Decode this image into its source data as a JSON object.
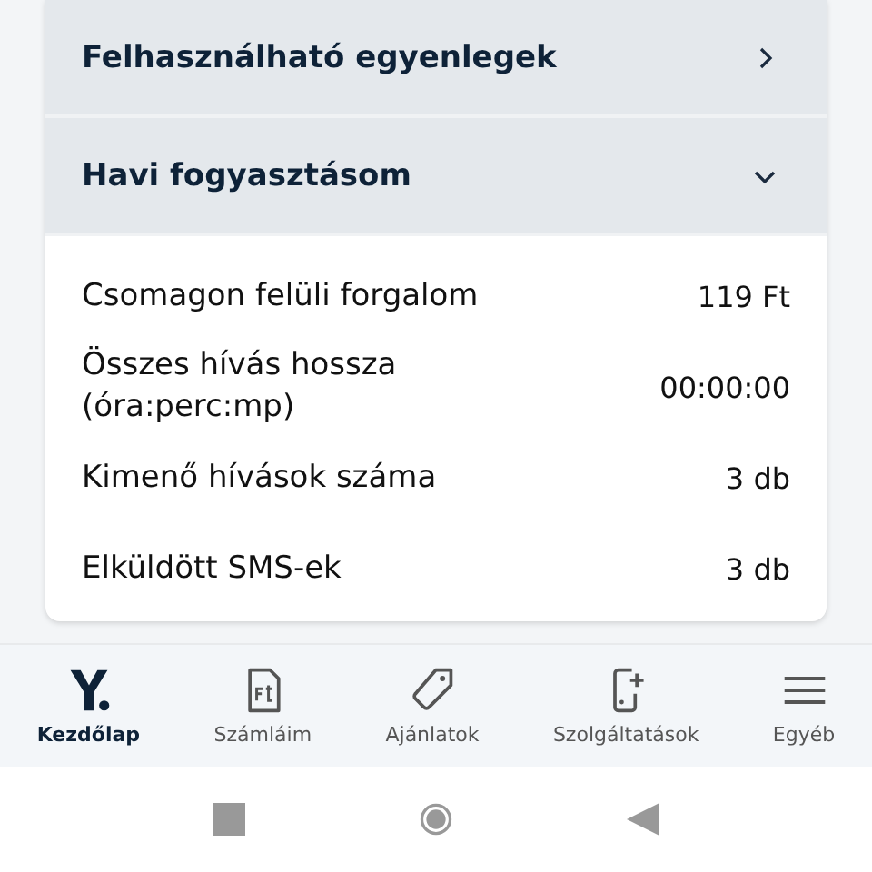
{
  "sections": [
    {
      "title": "Felhasználható egyenlegek",
      "expanded": false
    },
    {
      "title": "Havi fogyasztásom",
      "expanded": true,
      "rows": [
        {
          "label": "Csomagon felüli forgalom",
          "value": "119 Ft"
        },
        {
          "label": "Összes hívás hossza (óra:perc:mp)",
          "value": "00:00:00"
        },
        {
          "label": "Kimenő hívások száma",
          "value": "3 db"
        },
        {
          "label": "Elküldött SMS-ek",
          "value": "3 db"
        }
      ]
    }
  ],
  "bottom_nav": [
    {
      "label": "Kezdőlap",
      "kind": "logo",
      "selected": true
    },
    {
      "label": "Számláim",
      "kind": "invoice",
      "selected": false
    },
    {
      "label": "Ajánlatok",
      "kind": "tag",
      "selected": false
    },
    {
      "label": "Szolgáltatások",
      "kind": "phone",
      "selected": false
    },
    {
      "label": "Egyéb",
      "kind": "menu",
      "selected": false
    }
  ]
}
